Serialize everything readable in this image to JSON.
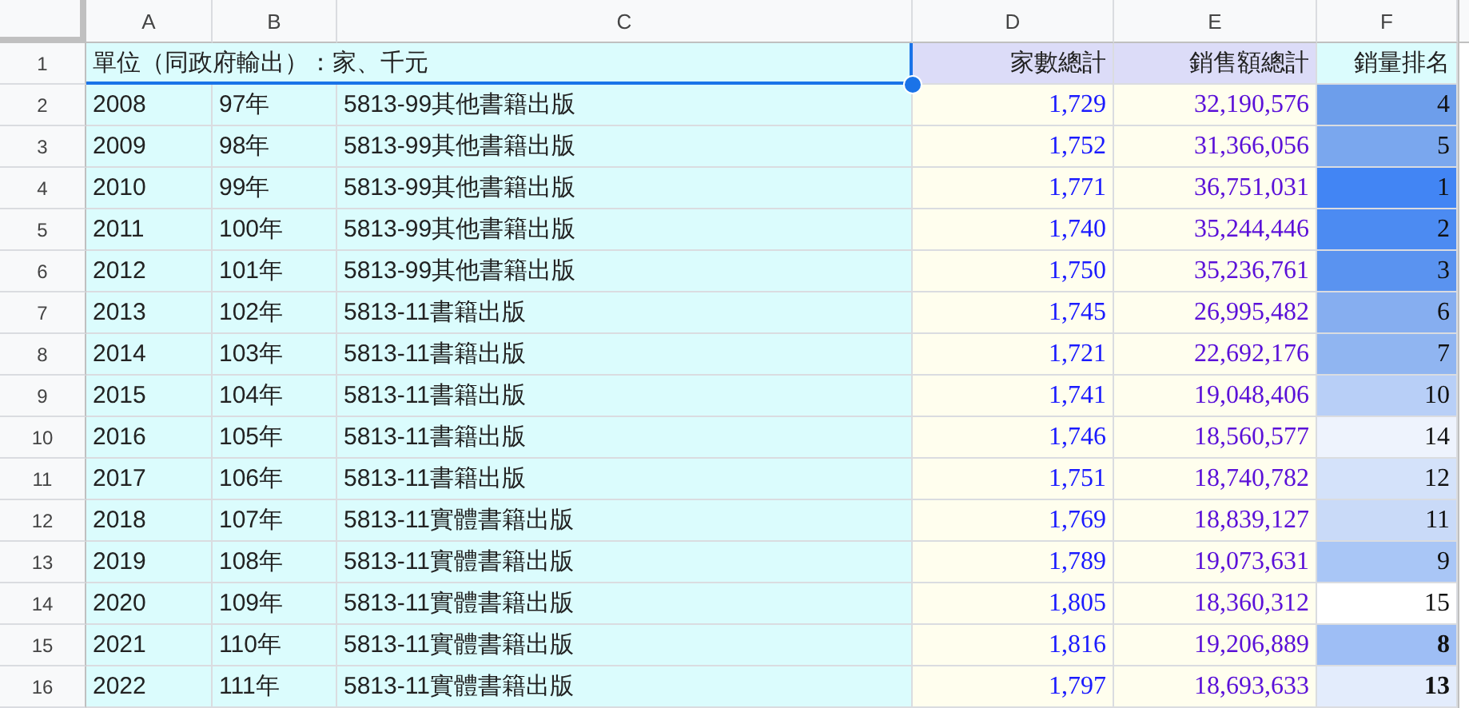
{
  "column_headers": [
    "A",
    "B",
    "C",
    "D",
    "E",
    "F"
  ],
  "header_row": {
    "row_number": "1",
    "title": "單位（同政府輸出）：家、千元",
    "selected": true,
    "headers": [
      "家數總計",
      "銷售額總計",
      "銷量排名"
    ]
  },
  "rows": [
    {
      "row_number": "2",
      "year": "2008",
      "roc_year": "97年",
      "industry": "5813-99其他書籍出版",
      "firms": "1,729",
      "sales": "32,190,576",
      "rank": "4",
      "color": "#6d9eeb",
      "bold": false
    },
    {
      "row_number": "3",
      "year": "2009",
      "roc_year": "98年",
      "industry": "5813-99其他書籍出版",
      "firms": "1,752",
      "sales": "31,366,056",
      "rank": "5",
      "color": "#7aa7ee",
      "bold": false
    },
    {
      "row_number": "4",
      "year": "2010",
      "roc_year": "99年",
      "industry": "5813-99其他書籍出版",
      "firms": "1,771",
      "sales": "36,751,031",
      "rank": "1",
      "color": "#4285f4",
      "bold": false
    },
    {
      "row_number": "5",
      "year": "2011",
      "roc_year": "100年",
      "industry": "5813-99其他書籍出版",
      "firms": "1,740",
      "sales": "35,244,446",
      "rank": "2",
      "color": "#4c8bf2",
      "bold": false
    },
    {
      "row_number": "6",
      "year": "2012",
      "roc_year": "101年",
      "industry": "5813-99其他書籍出版",
      "firms": "1,750",
      "sales": "35,236,761",
      "rank": "3",
      "color": "#5a93f0",
      "bold": false
    },
    {
      "row_number": "7",
      "year": "2013",
      "roc_year": "102年",
      "industry": "5813-11書籍出版",
      "firms": "1,745",
      "sales": "26,995,482",
      "rank": "6",
      "color": "#86aef0",
      "bold": false
    },
    {
      "row_number": "8",
      "year": "2014",
      "roc_year": "103年",
      "industry": "5813-11書籍出版",
      "firms": "1,721",
      "sales": "22,692,176",
      "rank": "7",
      "color": "#90b5f1",
      "bold": false
    },
    {
      "row_number": "9",
      "year": "2015",
      "roc_year": "104年",
      "industry": "5813-11書籍出版",
      "firms": "1,741",
      "sales": "19,048,406",
      "rank": "10",
      "color": "#b8cff7",
      "bold": false
    },
    {
      "row_number": "10",
      "year": "2016",
      "roc_year": "105年",
      "industry": "5813-11書籍出版",
      "firms": "1,746",
      "sales": "18,560,577",
      "rank": "14",
      "color": "#eef3fd",
      "bold": false
    },
    {
      "row_number": "11",
      "year": "2017",
      "roc_year": "106年",
      "industry": "5813-11書籍出版",
      "firms": "1,751",
      "sales": "18,740,782",
      "rank": "12",
      "color": "#d4e2fa",
      "bold": false
    },
    {
      "row_number": "12",
      "year": "2018",
      "roc_year": "107年",
      "industry": "5813-11實體書籍出版",
      "firms": "1,769",
      "sales": "18,839,127",
      "rank": "11",
      "color": "#c9daf8",
      "bold": false
    },
    {
      "row_number": "13",
      "year": "2019",
      "roc_year": "108年",
      "industry": "5813-11實體書籍出版",
      "firms": "1,789",
      "sales": "19,073,631",
      "rank": "9",
      "color": "#a9c6f6",
      "bold": false
    },
    {
      "row_number": "14",
      "year": "2020",
      "roc_year": "109年",
      "industry": "5813-11實體書籍出版",
      "firms": "1,805",
      "sales": "18,360,312",
      "rank": "15",
      "color": "#ffffff",
      "bold": false
    },
    {
      "row_number": "15",
      "year": "2021",
      "roc_year": "110年",
      "industry": "5813-11實體書籍出版",
      "firms": "1,816",
      "sales": "19,206,889",
      "rank": "8",
      "color": "#9ebef5",
      "bold": true
    },
    {
      "row_number": "16",
      "year": "2022",
      "roc_year": "111年",
      "industry": "5813-11實體書籍出版",
      "firms": "1,797",
      "sales": "18,693,633",
      "rank": "13",
      "color": "#e3ecfc",
      "bold": true
    }
  ]
}
